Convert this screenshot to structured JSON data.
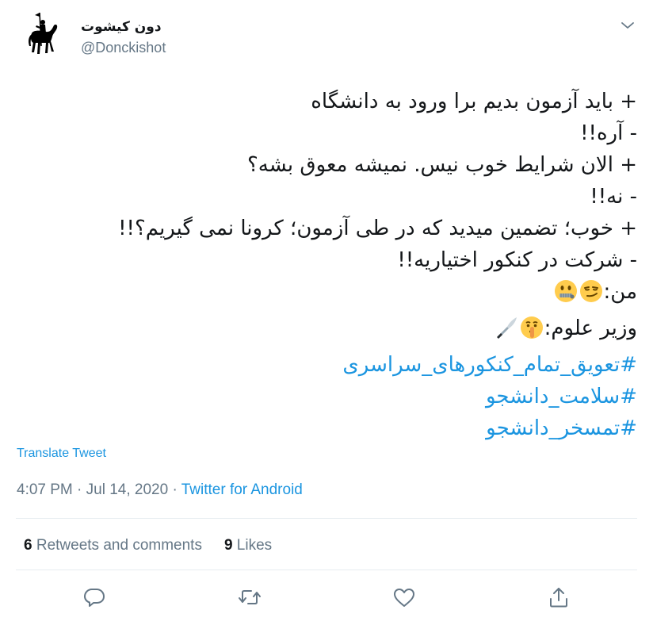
{
  "user": {
    "display_name": "دون کیشوت",
    "handle": "@Donckishot",
    "avatar_icon": "knight-on-horse-icon"
  },
  "tweet": {
    "lines": [
      "+ باید آزمون بدیم برا ورود به دانشگاه",
      "- آره!!",
      "+ الان شرایط خوب نیس. نمیشه معوق بشه؟",
      "- نه!!",
      "+ خوب؛ تضمین میدید که در طی آزمون؛ کرونا نمی گیریم؟!!",
      "- شرکت در کنکور اختیاریه!!"
    ],
    "me_label": "من:",
    "me_emojis": [
      "smirking-face-icon",
      "zipper-mouth-face-icon"
    ],
    "minister_label": "وزیر علوم:",
    "minister_emojis": [
      "shushing-face-icon",
      "kitchen-knife-icon"
    ],
    "hashtags": [
      "#تعویق_تمام_کنکورهای_سراسری",
      "#سلامت_دانشجو",
      "#تمسخر_دانشجو"
    ]
  },
  "translate_label": "Translate Tweet",
  "meta": {
    "time": "4:07 PM",
    "sep1": " · ",
    "date": "Jul 14, 2020",
    "sep2": " · ",
    "source": "Twitter for Android"
  },
  "stats": {
    "retweets_count": "6",
    "retweets_label": " Retweets and comments",
    "likes_count": "9",
    "likes_label": " Likes"
  },
  "actions": [
    "reply-icon",
    "retweet-icon",
    "like-icon",
    "share-icon"
  ],
  "colors": {
    "link": "#1b95e0",
    "text": "#14171a",
    "muted": "#657786",
    "border": "#e6ecf0"
  }
}
